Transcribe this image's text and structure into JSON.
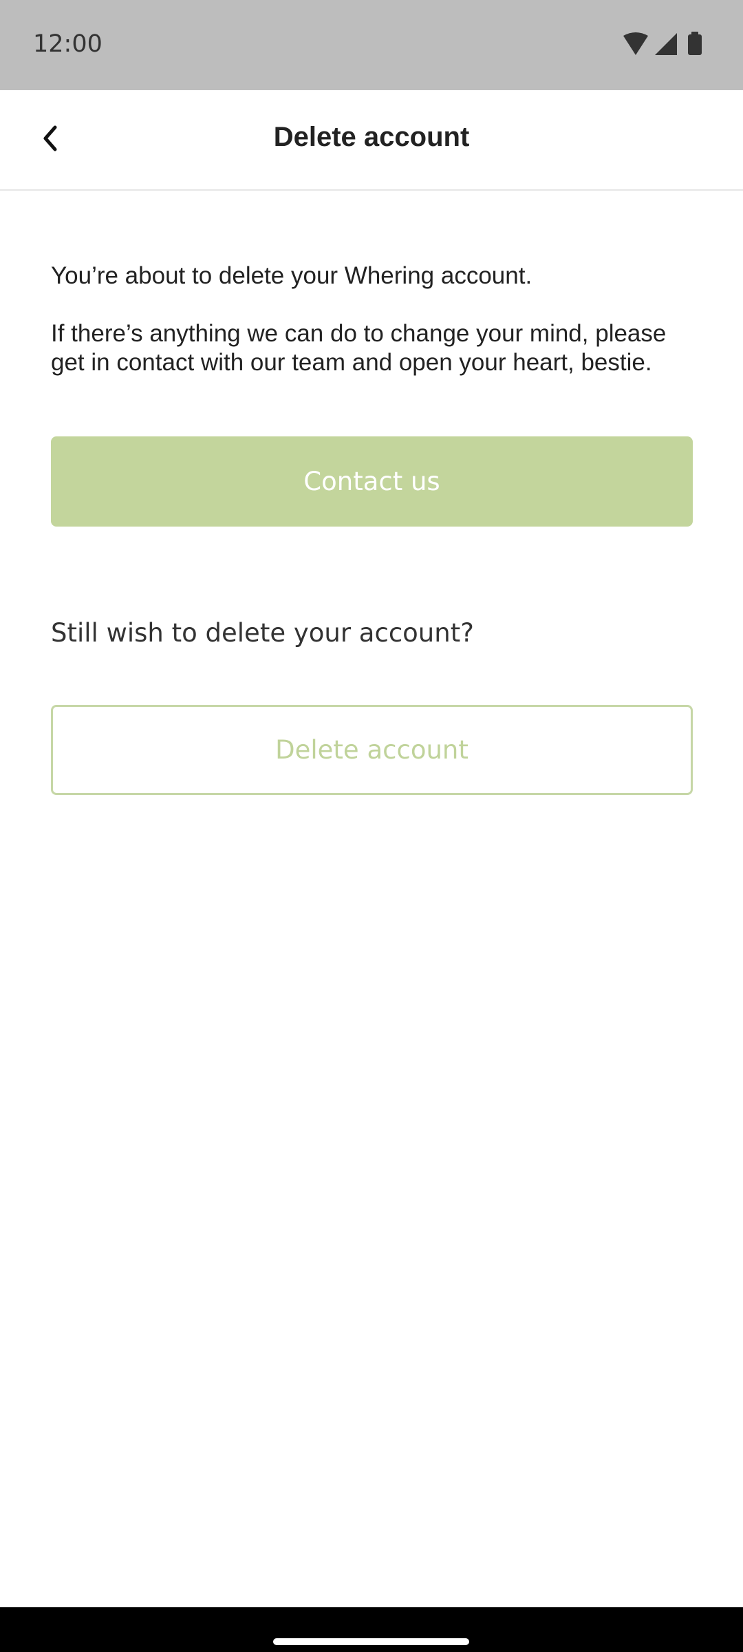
{
  "status_bar": {
    "time": "12:00",
    "icons": [
      "wifi-icon",
      "cellular-signal-icon",
      "battery-icon"
    ]
  },
  "header": {
    "title": "Delete account",
    "back_icon": "chevron-left-icon"
  },
  "main": {
    "message_line1": "You’re about to delete your Whering account.",
    "message_line2": "If there’s anything we can do to change your mind, please get in contact with our team and open your heart, bestie.",
    "contact_label": "Contact us",
    "still_wish_text": "Still wish to delete your account?",
    "delete_label": "Delete account"
  },
  "colors": {
    "accent": "#c3d59c",
    "status_bar_bg": "#bdbdbd",
    "nav_bar_bg": "#000000"
  }
}
